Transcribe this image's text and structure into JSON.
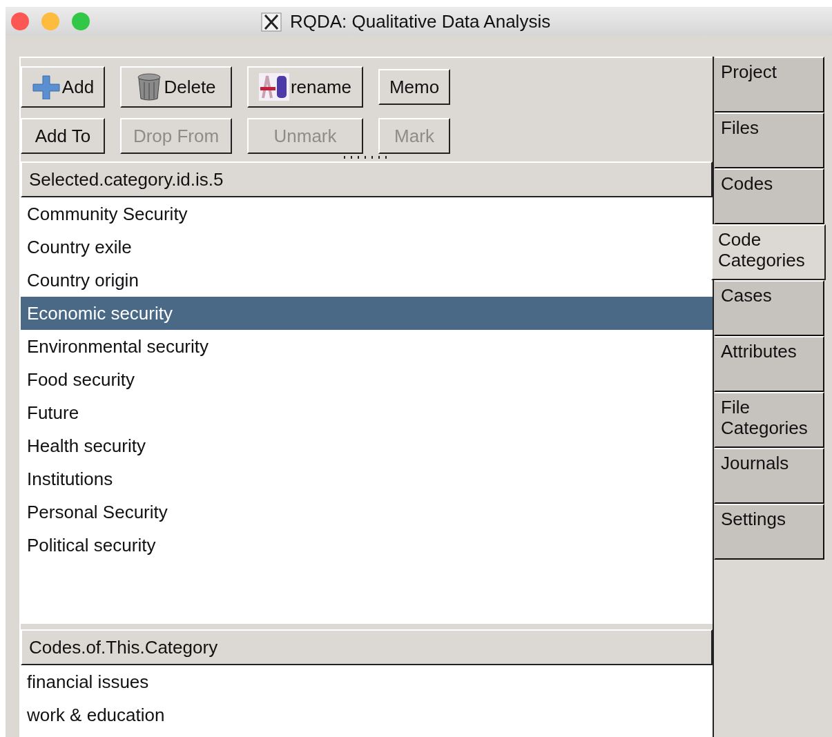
{
  "window": {
    "title": "RQDA: Qualitative Data Analysis"
  },
  "toolbar": [
    {
      "label": "Add",
      "kind": "add",
      "disabled": false
    },
    {
      "label": "Delete",
      "kind": "delete",
      "disabled": false
    },
    {
      "label": "rename",
      "kind": "rename",
      "disabled": false
    },
    {
      "label": "Memo",
      "kind": "text",
      "disabled": false
    },
    {
      "label": "Add To",
      "kind": "text",
      "disabled": false
    },
    {
      "label": "Drop From",
      "kind": "text",
      "disabled": true
    },
    {
      "label": "Unmark",
      "kind": "text",
      "disabled": true
    },
    {
      "label": "Mark",
      "kind": "text",
      "disabled": true
    }
  ],
  "category_list": {
    "header": "Selected.category.id.is.5",
    "items": [
      {
        "label": "Community Security",
        "selected": false
      },
      {
        "label": "Country exile",
        "selected": false
      },
      {
        "label": "Country origin",
        "selected": false
      },
      {
        "label": "Economic security",
        "selected": true
      },
      {
        "label": "Environmental security",
        "selected": false
      },
      {
        "label": "Food security",
        "selected": false
      },
      {
        "label": "Future",
        "selected": false
      },
      {
        "label": "Health security",
        "selected": false
      },
      {
        "label": "Institutions",
        "selected": false
      },
      {
        "label": "Personal Security",
        "selected": false
      },
      {
        "label": "Political security",
        "selected": false
      }
    ]
  },
  "codes_list": {
    "header": "Codes.of.This.Category",
    "items": [
      {
        "label": "financial issues",
        "selected": false
      },
      {
        "label": "work & education",
        "selected": false
      }
    ]
  },
  "tabs": [
    {
      "label": "Project",
      "selected": false
    },
    {
      "label": "Files",
      "selected": false
    },
    {
      "label": "Codes",
      "selected": false
    },
    {
      "label": "Code Categories",
      "selected": true
    },
    {
      "label": "Cases",
      "selected": false
    },
    {
      "label": "Attributes",
      "selected": false
    },
    {
      "label": "File Categories",
      "selected": false
    },
    {
      "label": "Journals",
      "selected": false
    },
    {
      "label": "Settings",
      "selected": false
    }
  ]
}
